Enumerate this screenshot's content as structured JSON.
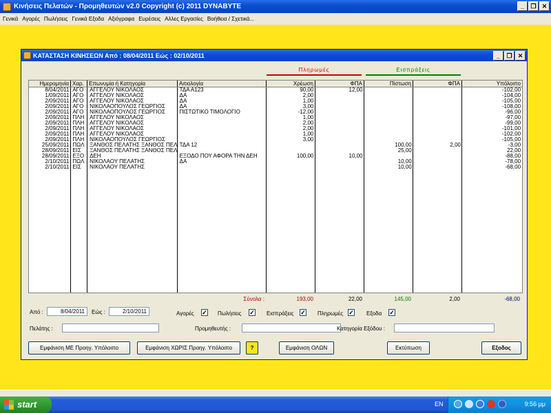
{
  "app": {
    "title": "Κινήσεις Πελατών - Προμηθευτών  v2.0   Copyright (c) 2011  DYNABYTE",
    "menu": [
      "Γενικά",
      "Αγορές",
      "Πωλήσεις",
      "Γενικά Εξοδα",
      "Αξιόγραφα",
      "Ευρέσεις",
      "Αλλες Εργασίες",
      "Βοήθεια / Σχετικά..."
    ]
  },
  "window": {
    "title": "ΚΑΤΑΣΤΑΣΗ ΚΙΝΗΣΕΩΝ Από : 08/04/2011   Εώς : 02/10/2011",
    "section_payments": "Πληρωμές",
    "section_receipts": "Εισπράξεις"
  },
  "table": {
    "columns": [
      "Ημερομηνία",
      "Χαρ.",
      "Επωνυμία ή Κατηγορία",
      "Αιτιολογία",
      "Χρέωση",
      "ΦΠΑ",
      "Πίστωση",
      "ΦΠΑ",
      "Υπόλοιπο"
    ],
    "rows": [
      [
        "8/04/2011",
        "ΑΓΟ",
        "ΑΓΓΕΛΟΥ ΝΙΚΟΛΑΟΣ",
        "ΤΔΑ  Α123",
        "90,00",
        "12,00",
        "",
        "",
        "-102,00"
      ],
      [
        "1/09/2011",
        "ΑΓΟ",
        "ΑΓΓΕΛΟΥ ΝΙΚΟΛΑΟΣ",
        "ΔΑ",
        "2,00",
        "",
        "",
        "",
        "-104,00"
      ],
      [
        "2/09/2011",
        "ΑΓΟ",
        "ΑΓΓΕΛΟΥ ΝΙΚΟΛΑΟΣ",
        "ΔΑ",
        "1,00",
        "",
        "",
        "",
        "-105,00"
      ],
      [
        "2/09/2011",
        "ΑΓΟ",
        "ΝΙΚΟΛΑΟΠΟΥΛΟΣ ΓΕΩΡΓΙΟΣ",
        "ΔΑ",
        "3,00",
        "",
        "",
        "",
        "-108,00"
      ],
      [
        "2/09/2011",
        "ΑΓΟ",
        "ΝΙΚΟΛΑΟΠΟΥΛΟΣ ΓΕΩΡΓΙΟΣ",
        "ΠΙΣΤΩΤΙΚΟ ΤΙΜΟΛΟΓΙΟ",
        "-12,00",
        "",
        "",
        "",
        "-96,00"
      ],
      [
        "2/09/2011",
        "ΠΛΗ",
        "ΑΓΓΕΛΟΥ ΝΙΚΟΛΑΟΣ",
        "",
        "1,00",
        "",
        "",
        "",
        "-97,00"
      ],
      [
        "2/09/2011",
        "ΠΛΗ",
        "ΑΓΓΕΛΟΥ ΝΙΚΟΛΑΟΣ",
        "",
        "2,00",
        "",
        "",
        "",
        "-99,00"
      ],
      [
        "2/09/2011",
        "ΠΛΗ",
        "ΑΓΓΕΛΟΥ ΝΙΚΟΛΑΟΣ",
        "",
        "2,00",
        "",
        "",
        "",
        "-101,00"
      ],
      [
        "2/09/2011",
        "ΠΛΗ",
        "ΑΓΓΕΛΟΥ ΝΙΚΟΛΑΟΣ",
        "",
        "1,00",
        "",
        "",
        "",
        "-102,00"
      ],
      [
        "2/09/2011",
        "ΠΛΗ",
        "ΝΙΚΟΛΑΟΠΟΥΛΟΣ ΓΕΩΡΓΙΟΣ",
        "",
        "3,00",
        "",
        "",
        "",
        "-105,00"
      ],
      [
        "25/09/2011",
        "ΠΩΛ",
        "ΞΑΝΘΟΣ ΠΕΛΑΤΗΣ ΞΑΝΘΟΣ ΠΕΛΑ",
        "ΤΔΑ  12",
        "",
        "",
        "100,00",
        "2,00",
        "-3,00"
      ],
      [
        "28/09/2011",
        "ΕΙΣ",
        "ΞΑΝΘΟΣ ΠΕΛΑΤΗΣ ΞΑΝΘΟΣ ΠΕΛΑ",
        "",
        "",
        "",
        "25,00",
        "",
        "22,00"
      ],
      [
        "28/09/2011",
        "ΕΞΟ",
        "ΔΕΗ",
        "ΕΞΟΔΟ ΠΟΥ ΑΦΟΡΑ ΤΗΝ ΔΕΗ",
        "100,00",
        "10,00",
        "",
        "",
        "-88,00"
      ],
      [
        "2/10/2011",
        "ΠΩΛ",
        "ΝΙΚΟΛΑΟΥ ΠΕΛΑΤΗΣ",
        "ΔΑ",
        "",
        "",
        "10,00",
        "",
        "-78,00"
      ],
      [
        "2/10/2011",
        "ΕΙΣ",
        "ΝΙΚΟΛΑΟΥ ΠΕΛΑΤΗΣ",
        "",
        "",
        "",
        "10,00",
        "",
        "-68,00"
      ]
    ],
    "totals": {
      "label": "Σύνολα :",
      "charge": "193,00",
      "vat1": "22,00",
      "credit": "145,00",
      "vat2": "2,00",
      "balance": "-68,00"
    }
  },
  "filters": {
    "from_label": "Από :",
    "from_value": "8/04/2011",
    "to_label": "Εώς :",
    "to_value": "2/10/2011",
    "checks": [
      {
        "label": "Αγορές",
        "checked": "✓"
      },
      {
        "label": "Πωλήσεις",
        "checked": "✓"
      },
      {
        "label": "Εισπράξεις",
        "checked": "✓"
      },
      {
        "label": "Πληρωμές",
        "checked": "✓"
      },
      {
        "label": "Εξοδα",
        "checked": "✓"
      }
    ],
    "customer_label": "Πελάτης :",
    "customer_value": "",
    "supplier_label": "Προμηθευτής :",
    "supplier_value": "",
    "expense_cat_label": "Κατηγορία Εξόδου :",
    "expense_cat_value": ""
  },
  "buttons": {
    "show_with_prev": "Εμφάνιση ΜΕ Προηγ. Υπόλοιπο",
    "show_without_prev": "Εμφάνιση ΧΩΡΙΣ Προηγ. Υπόλοιπο",
    "help": "?",
    "show_all": "Εμφάνιση ΟΛΩΝ",
    "print": "Εκτύπωση",
    "exit": "Εξοδος"
  },
  "taskbar": {
    "start": "start",
    "lang": "EN",
    "clock": "9:56 μμ"
  },
  "window_controls": {
    "minimize": "_",
    "restore": "❐",
    "close": "✕"
  }
}
